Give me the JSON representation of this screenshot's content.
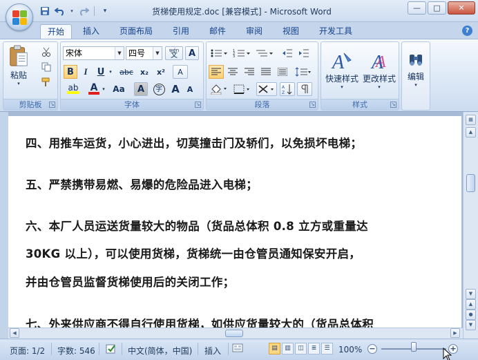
{
  "window": {
    "title": "货梯使用规定.doc [兼容模式] - Microsoft Word",
    "controls": {
      "minimize": "—",
      "maximize": "□",
      "close": "✕"
    }
  },
  "qat": {
    "save_icon": "save-icon",
    "undo_icon": "undo-icon",
    "redo_icon": "redo-icon",
    "customize_icon": "customize-icon"
  },
  "tabs": [
    {
      "label": "开始",
      "active": true
    },
    {
      "label": "插入"
    },
    {
      "label": "页面布局"
    },
    {
      "label": "引用"
    },
    {
      "label": "邮件"
    },
    {
      "label": "审阅"
    },
    {
      "label": "视图"
    },
    {
      "label": "开发工具"
    }
  ],
  "ribbon": {
    "clipboard": {
      "label": "剪贴板",
      "paste": "粘贴"
    },
    "font": {
      "label": "字体",
      "font_name": "宋体",
      "font_size": "四号",
      "wen": "wén",
      "wen_char": "文",
      "border_char": "A",
      "bold": "B",
      "italic": "I",
      "underline": "U",
      "strike": "abc",
      "subscript": "x₂",
      "superscript": "x²",
      "clear": "A",
      "font_color": "A",
      "change_case": "Aa",
      "char_shading": "A",
      "enclose": "字",
      "grow": "A",
      "shrink": "A",
      "font_color_hex": "#e02020",
      "highlight_hex": "#ffff00"
    },
    "paragraph": {
      "label": "段落"
    },
    "styles": {
      "label": "样式",
      "quick_styles": "快速样式",
      "change_styles": "更改样式"
    },
    "editing": {
      "label": "编辑"
    }
  },
  "document": {
    "paragraphs": [
      {
        "text": "四、用推车运货，小心进出，切莫撞击门及轿们，以免损坏电梯；"
      },
      {
        "text": "五、严禁携带易燃、易爆的危险品进入电梯；"
      },
      {
        "line1a": "六、本厂人员运送货量较大的物品（货品总体积 ",
        "line1b": "0.8",
        "line1c": " 立方或重量达"
      },
      {
        "line2a": "30KG",
        "line2b": " 以上），可以使用货梯，货梯统一由仓管员通知保安开启，"
      },
      {
        "text": "并由仓管员监督货梯使用后的关闭工作；"
      },
      {
        "text": "七、外来供应商不得自行使用货梯，如供应货量较大的（货品总体积"
      }
    ]
  },
  "statusbar": {
    "page": "页面: 1/2",
    "words": "字数: 546",
    "language": "中文(简体，中国)",
    "mode": "插入",
    "zoom": "100%",
    "zoom_level": 0.5
  },
  "colors": {
    "accent": "#15428b",
    "ribbon_bg": "#dbe7f6"
  }
}
